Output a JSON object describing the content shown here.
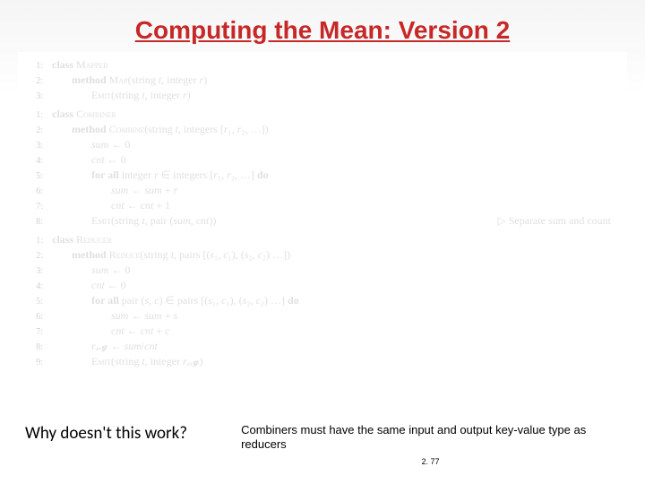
{
  "title": "Computing the Mean: Version 2",
  "mapper": {
    "lines": [
      {
        "n": "1:",
        "cls": "",
        "text": "class MAPPER"
      },
      {
        "n": "2:",
        "cls": "ind1",
        "text": "method MAP(string t, integer r)"
      },
      {
        "n": "3:",
        "cls": "ind2",
        "text": "EMIT(string t, integer r)"
      }
    ]
  },
  "combiner": {
    "lines": [
      {
        "n": "1:",
        "cls": "",
        "text": "class COMBINER"
      },
      {
        "n": "2:",
        "cls": "ind1",
        "text": "method COMBINE(string t, integers [r₁, r₂, …])"
      },
      {
        "n": "3:",
        "cls": "ind2",
        "text": "sum ← 0"
      },
      {
        "n": "4:",
        "cls": "ind2",
        "text": "cnt ← 0"
      },
      {
        "n": "5:",
        "cls": "ind2",
        "text": "for all integer r ∈ integers [r₁, r₂, …] do"
      },
      {
        "n": "6:",
        "cls": "ind3",
        "text": "sum ← sum + r"
      },
      {
        "n": "7:",
        "cls": "ind3",
        "text": "cnt ← cnt + 1"
      },
      {
        "n": "8:",
        "cls": "ind2",
        "text": "EMIT(string t, pair (sum, cnt))",
        "comment": "▷ Separate sum and count"
      }
    ]
  },
  "reducer": {
    "lines": [
      {
        "n": "1:",
        "cls": "",
        "text": "class REDUCER"
      },
      {
        "n": "2:",
        "cls": "ind1",
        "text": "method REDUCE(string t, pairs [(s₁, c₁), (s₂, c₂) …])"
      },
      {
        "n": "3:",
        "cls": "ind2",
        "text": "sum ← 0"
      },
      {
        "n": "4:",
        "cls": "ind2",
        "text": "cnt ← 0"
      },
      {
        "n": "5:",
        "cls": "ind2",
        "text": "for all pair (s, c) ∈ pairs [(s₁, c₁), (s₂, c₂) …] do"
      },
      {
        "n": "6:",
        "cls": "ind3",
        "text": "sum ← sum + s"
      },
      {
        "n": "7:",
        "cls": "ind3",
        "text": "cnt ← cnt + c"
      },
      {
        "n": "8:",
        "cls": "ind2",
        "text": "rₐᵥ𝓰 ← sum/cnt"
      },
      {
        "n": "9:",
        "cls": "ind2",
        "text": "EMIT(string t, integer rₐᵥ𝓰)"
      }
    ]
  },
  "question": "Why doesn't this work?",
  "note": "Combiners must have the same input and output key-value type as reducers",
  "pagenum": "2. 77"
}
